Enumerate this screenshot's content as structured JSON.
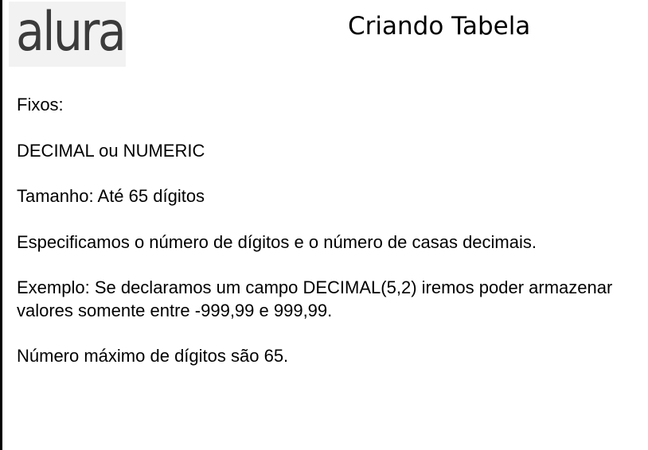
{
  "logo": {
    "text": "alura"
  },
  "slide": {
    "title": "Criando Tabela",
    "paragraphs": [
      "Fixos:",
      "DECIMAL ou NUMERIC",
      "Tamanho: Até 65 dígitos",
      "Especificamos o número de dígitos e o número de casas decimais.",
      "Exemplo: Se declaramos um campo DECIMAL(5,2) iremos poder armazenar valores somente entre -999,99 e 999,99.",
      "Número máximo de dígitos são 65."
    ]
  },
  "colors": {
    "logo_background": "#f2f2f2",
    "logo_text": "#3b3b3b",
    "text": "#000000"
  }
}
